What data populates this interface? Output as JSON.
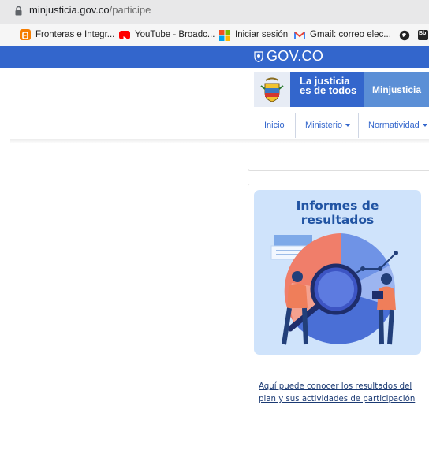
{
  "browser": {
    "url_host": "minjusticia.gov.co",
    "url_path": "/participe",
    "bookmarks": [
      {
        "label": "Fronteras e Integr...",
        "icon": "blogger-icon",
        "color": "#f57d00"
      },
      {
        "label": "YouTube - Broadc...",
        "icon": "youtube-icon",
        "color": "#ff0000"
      },
      {
        "label": "Iniciar sesión",
        "icon": "microsoft-icon",
        "color": "#f25022"
      },
      {
        "label": "Gmail: correo elec...",
        "icon": "gmail-icon",
        "color": "#ea4335"
      },
      {
        "label": "",
        "icon": "globe-icon",
        "color": "#222222"
      },
      {
        "label": "Bb",
        "icon": "blackboard-icon",
        "color": "#262626"
      }
    ]
  },
  "gov_bar": {
    "label": "GOV.CO",
    "color": "#3366cc"
  },
  "header": {
    "logo_line1": "La justicia",
    "logo_line2": "es de todos",
    "minjusticia": "Minjusticia",
    "nav": [
      {
        "label": "Inicio",
        "has_dropdown": false
      },
      {
        "label": "Ministerio",
        "has_dropdown": true
      },
      {
        "label": "Normatividad",
        "has_dropdown": true
      }
    ]
  },
  "card": {
    "illustration_title_line1": "Informes de",
    "illustration_title_line2": "resultados",
    "link_line1": "Aquí puede conocer los resultados del",
    "link_line2": "plan y sus actividades de participación"
  }
}
